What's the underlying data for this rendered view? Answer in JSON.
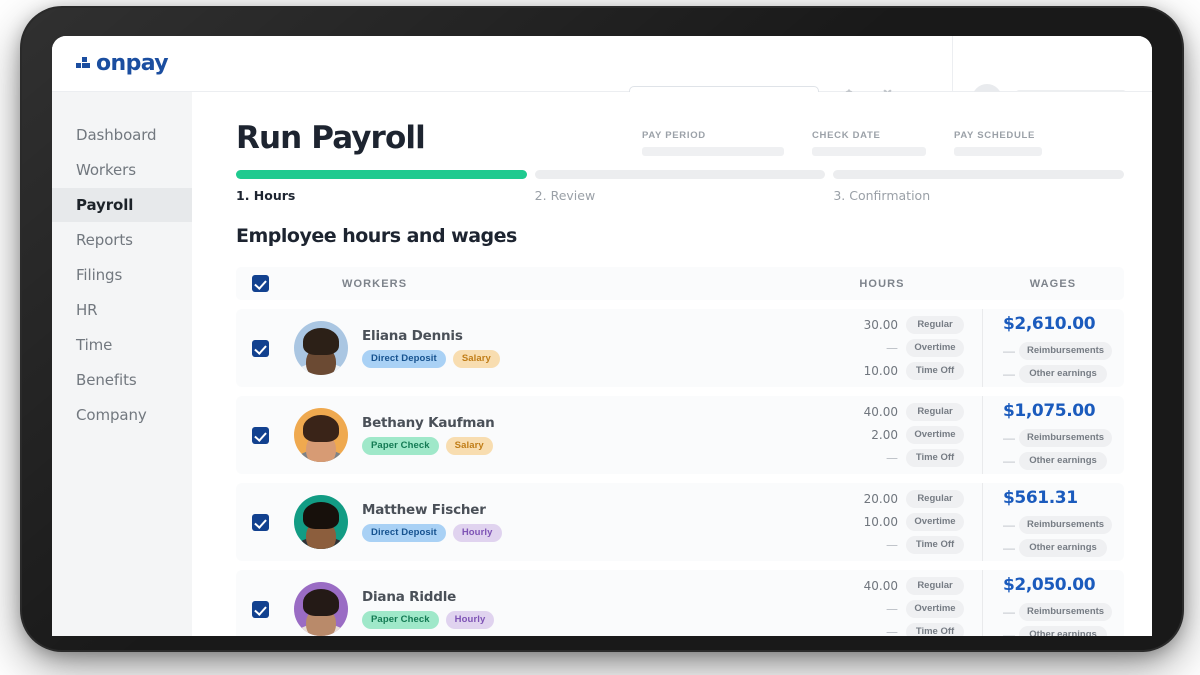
{
  "brand": {
    "logo_text": "onpay",
    "logo_icon": "onpay-squares-icon",
    "accent_blue": "#1b4ea0",
    "progress_green": "#1fca8f",
    "amount_blue": "#1b5bbd"
  },
  "topbar": {
    "search_placeholder": "",
    "search_icon": "search-icon",
    "bell_icon": "▲",
    "gift_icon": "☗",
    "help_icon": "?",
    "chevron_icon": "chevron-down-icon"
  },
  "sidebar": {
    "items": [
      {
        "label": "Dashboard",
        "active": false
      },
      {
        "label": "Workers",
        "active": false
      },
      {
        "label": "Payroll",
        "active": true
      },
      {
        "label": "Reports",
        "active": false
      },
      {
        "label": "Filings",
        "active": false
      },
      {
        "label": "HR",
        "active": false
      },
      {
        "label": "Time",
        "active": false
      },
      {
        "label": "Benefits",
        "active": false
      },
      {
        "label": "Company",
        "active": false
      }
    ]
  },
  "main": {
    "page_title": "Run Payroll",
    "section_title": "Employee hours and wages",
    "meta": [
      {
        "label": "PAY PERIOD",
        "value": ""
      },
      {
        "label": "CHECK DATE",
        "value": ""
      },
      {
        "label": "PAY SCHEDULE",
        "value": ""
      }
    ],
    "steps": [
      {
        "label": "1. Hours",
        "done": true
      },
      {
        "label": "2. Review",
        "done": false
      },
      {
        "label": "3. Confirmation",
        "done": false
      }
    ],
    "table": {
      "headers": {
        "workers": "WORKERS",
        "hours": "HOURS",
        "wages": "WAGES"
      },
      "select_all_checked": true,
      "hour_tags": {
        "regular": "Regular",
        "overtime": "Overtime",
        "timeoff": "Time Off"
      },
      "wage_tags": {
        "reimbursements": "Reimbursements",
        "other": "Other earnings"
      },
      "dash": "—",
      "rows": [
        {
          "checked": true,
          "name": "Eliana Dennis",
          "badges": [
            {
              "text": "Direct Deposit",
              "type": "deposit"
            },
            {
              "text": "Salary",
              "type": "salary"
            }
          ],
          "avatar": {
            "bg": "#aac6e2",
            "hair": "#2c2017",
            "skin": "#6b4a33",
            "shirt": "#eef2f6"
          },
          "hours": {
            "regular": "30.00",
            "overtime": "—",
            "timeoff": "10.00"
          },
          "amount": "$2,610.00",
          "reimbursements": "—",
          "other_earnings": "—"
        },
        {
          "checked": true,
          "name": "Bethany Kaufman",
          "badges": [
            {
              "text": "Paper Check",
              "type": "check"
            },
            {
              "text": "Salary",
              "type": "salary"
            }
          ],
          "avatar": {
            "bg": "#efa94f",
            "hair": "#3a2418",
            "skin": "#d79b74",
            "shirt": "#7d8288"
          },
          "hours": {
            "regular": "40.00",
            "overtime": "2.00",
            "timeoff": "—"
          },
          "amount": "$1,075.00",
          "reimbursements": "—",
          "other_earnings": "—"
        },
        {
          "checked": true,
          "name": "Matthew Fischer",
          "badges": [
            {
              "text": "Direct Deposit",
              "type": "deposit"
            },
            {
              "text": "Hourly",
              "type": "hourly"
            }
          ],
          "avatar": {
            "bg": "#129c84",
            "hair": "#17100b",
            "skin": "#8c5e3d",
            "shirt": "#2e3238"
          },
          "hours": {
            "regular": "20.00",
            "overtime": "10.00",
            "timeoff": "—"
          },
          "amount": "$561.31",
          "reimbursements": "—",
          "other_earnings": "—"
        },
        {
          "checked": true,
          "name": "Diana Riddle",
          "badges": [
            {
              "text": "Paper Check",
              "type": "check"
            },
            {
              "text": "Hourly",
              "type": "hourly"
            }
          ],
          "avatar": {
            "bg": "#9a6cc4",
            "hair": "#241a16",
            "skin": "#b98a6a",
            "shirt": "#e8dfd8"
          },
          "hours": {
            "regular": "40.00",
            "overtime": "—",
            "timeoff": "—"
          },
          "amount": "$2,050.00",
          "reimbursements": "—",
          "other_earnings": "—"
        }
      ]
    }
  }
}
